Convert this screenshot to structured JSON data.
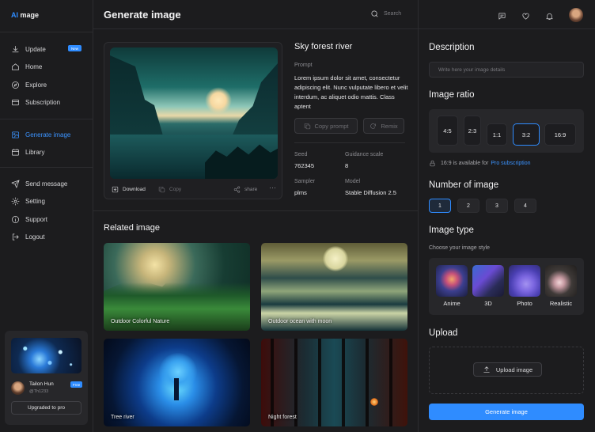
{
  "brand": {
    "name_accent": "AI",
    "name": " mage"
  },
  "sidebar": {
    "items": [
      {
        "label": "Update",
        "icon": "download-icon",
        "badge": "New"
      },
      {
        "label": "Home",
        "icon": "home-icon"
      },
      {
        "label": "Explore",
        "icon": "compass-icon"
      },
      {
        "label": "Subscription",
        "icon": "card-icon"
      },
      {
        "label": "Generate image",
        "icon": "image-icon",
        "active": true
      },
      {
        "label": "Library",
        "icon": "library-icon"
      },
      {
        "label": "Send message",
        "icon": "send-icon"
      },
      {
        "label": "Setting",
        "icon": "gear-icon"
      },
      {
        "label": "Support",
        "icon": "info-icon"
      },
      {
        "label": "Logout",
        "icon": "logout-icon"
      }
    ],
    "user": {
      "name": "Tailon Hun",
      "handle": "@Th1233",
      "plan": "Free",
      "upgrade_label": "Upgraded to pro"
    }
  },
  "header": {
    "title": "Generate image",
    "search_placeholder": "Search"
  },
  "detail": {
    "title": "Sky forest river",
    "prompt_label": "Prompt",
    "prompt": "Lorem ipsum dolor sit amet, consectetur adipiscing elit. Nunc vulputate libero et velit interdum, ac aliquet odio mattis. Class aptent",
    "copy_prompt": "Copy prompt",
    "remix": "Remix",
    "download": "Download",
    "copy": "Copy",
    "share": "share",
    "seed_label": "Seed",
    "seed": "762345",
    "guidance_label": "Guidance scale",
    "guidance": "8",
    "sampler_label": "Sampler",
    "sampler": "plms",
    "model_label": "Model",
    "model": "Stable Diffusion 2.5"
  },
  "related": {
    "title": "Related image",
    "items": [
      {
        "caption": "Outdoor Colorful Nature"
      },
      {
        "caption": "Outdoor ocean with moon"
      },
      {
        "caption": "Tree river"
      },
      {
        "caption": "Night forest"
      }
    ]
  },
  "panel": {
    "description_title": "Description",
    "description_placeholder": "Write here your image details",
    "ratio_title": "Image ratio",
    "ratios": [
      "4:5",
      "2:3",
      "1:1",
      "3:2",
      "16:9"
    ],
    "ratio_selected": "3:2",
    "ratio_note": "16:9 is available for",
    "ratio_note_link": "Pro subscription",
    "number_title": "Number of image",
    "numbers": [
      "1",
      "2",
      "3",
      "4"
    ],
    "number_selected": "1",
    "type_title": "Image type",
    "type_subtitle": "Choose your image style",
    "types": [
      "Anime",
      "3D",
      "Photo",
      "Realistic"
    ],
    "upload_title": "Upload",
    "upload_button": "Upload image",
    "generate_button": "Generate image"
  },
  "colors": {
    "accent": "#2f8cff",
    "background": "#1c1c1e",
    "panel": "#27272a"
  }
}
